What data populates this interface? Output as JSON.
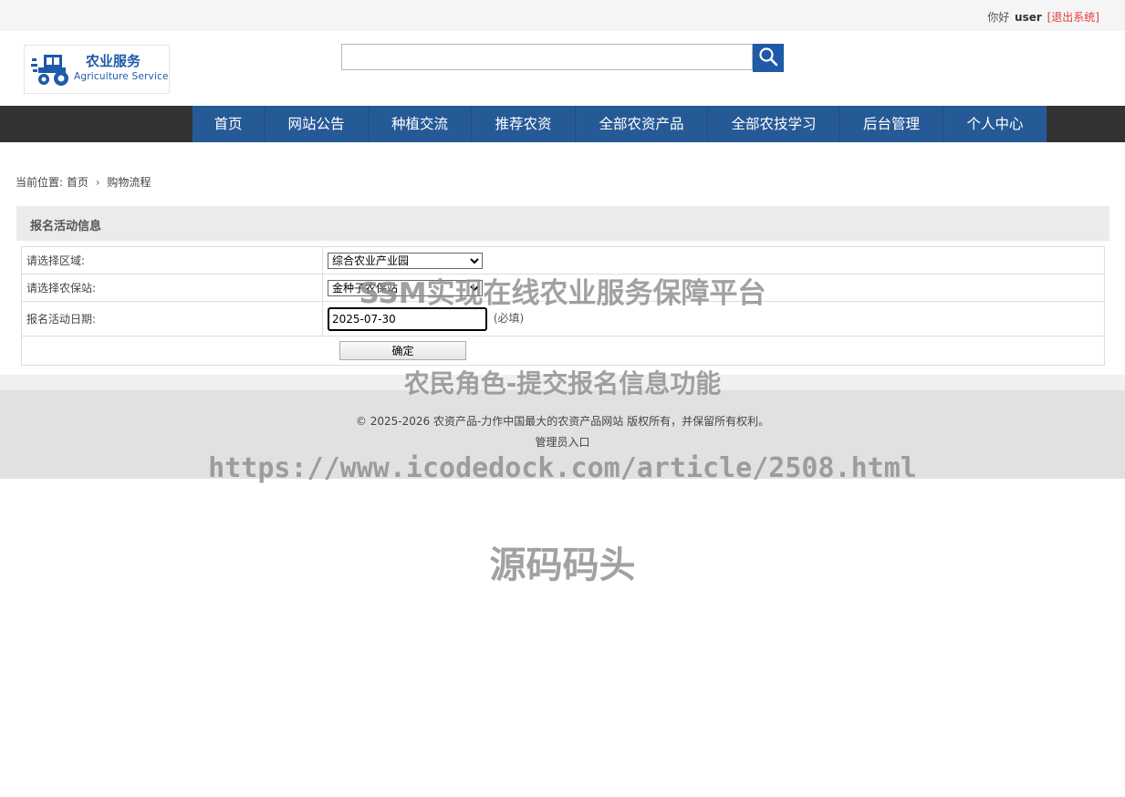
{
  "topbar": {
    "greeting": "你好",
    "username": "user",
    "logout": "[退出系统]"
  },
  "logo": {
    "title": "农业服务",
    "subtitle": "Agriculture Service",
    "icon": "tractor-icon"
  },
  "search": {
    "value": "",
    "placeholder": "",
    "icon": "search-icon"
  },
  "nav": {
    "items": [
      "首页",
      "网站公告",
      "种植交流",
      "推荐农资",
      "全部农资产品",
      "全部农技学习",
      "后台管理",
      "个人中心"
    ]
  },
  "breadcrumb": {
    "prefix": "当前位置:",
    "home": "首页",
    "current": "购物流程"
  },
  "panel": {
    "title": "报名活动信息"
  },
  "form": {
    "region_label": "请选择区域:",
    "region_value": "综合农业产业园",
    "station_label": "请选择农保站:",
    "station_value": "金种子农保站",
    "date_label": "报名活动日期:",
    "date_value": "2025-07-30",
    "required_note": "(必填)",
    "submit_label": "确定"
  },
  "footer": {
    "copyright": "© 2025-2026 农资产品-力作中国最大的农资产品网站 版权所有，并保留所有权利。",
    "admin_link": "管理员入口"
  },
  "watermarks": [
    "SSM实现在线农业服务保障平台",
    "农民角色-提交报名信息功能",
    "https://www.icodedock.com/article/2508.html",
    "源码码头"
  ],
  "colors": {
    "nav_blue": "#265a96",
    "nav_dark": "#333333",
    "logout_red": "#e4393c",
    "brand_blue": "#1e5aa8"
  }
}
